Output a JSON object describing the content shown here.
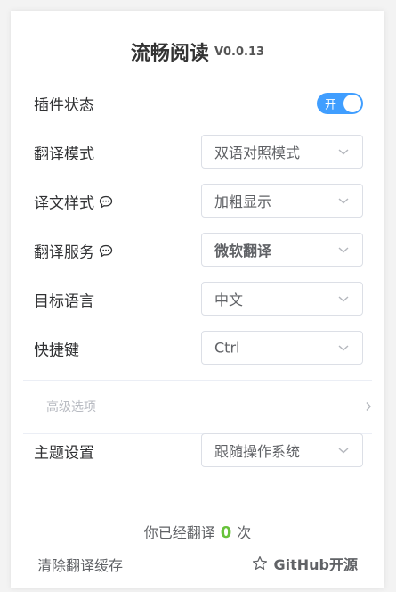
{
  "header": {
    "title": "流畅阅读",
    "version": "V0.0.13"
  },
  "settings": {
    "plugin_status": {
      "label": "插件状态",
      "toggle_text": "开",
      "on": true,
      "toggle_color": "#409eff"
    },
    "translate_mode": {
      "label": "翻译模式",
      "value": "双语对照模式"
    },
    "translation_style": {
      "label": "译文样式",
      "value": "加粗显示"
    },
    "translation_service": {
      "label": "翻译服务",
      "value": "微软翻译"
    },
    "target_language": {
      "label": "目标语言",
      "value": "中文"
    },
    "shortcut": {
      "label": "快捷键",
      "value": "Ctrl"
    },
    "advanced": {
      "label": "高级选项"
    },
    "theme": {
      "label": "主题设置",
      "value": "跟随操作系统"
    }
  },
  "stats": {
    "prefix": "你已经翻译",
    "count": "0",
    "suffix": "次",
    "count_color": "#67c23a"
  },
  "footer": {
    "clear_cache": "清除翻译缓存",
    "github_text": "GitHub开源"
  },
  "icons": {
    "help": "chat-bubble-help-icon",
    "chevron": "chevron-down-icon",
    "advanced_chevron": "chevron-right-icon",
    "github": "star-icon"
  }
}
